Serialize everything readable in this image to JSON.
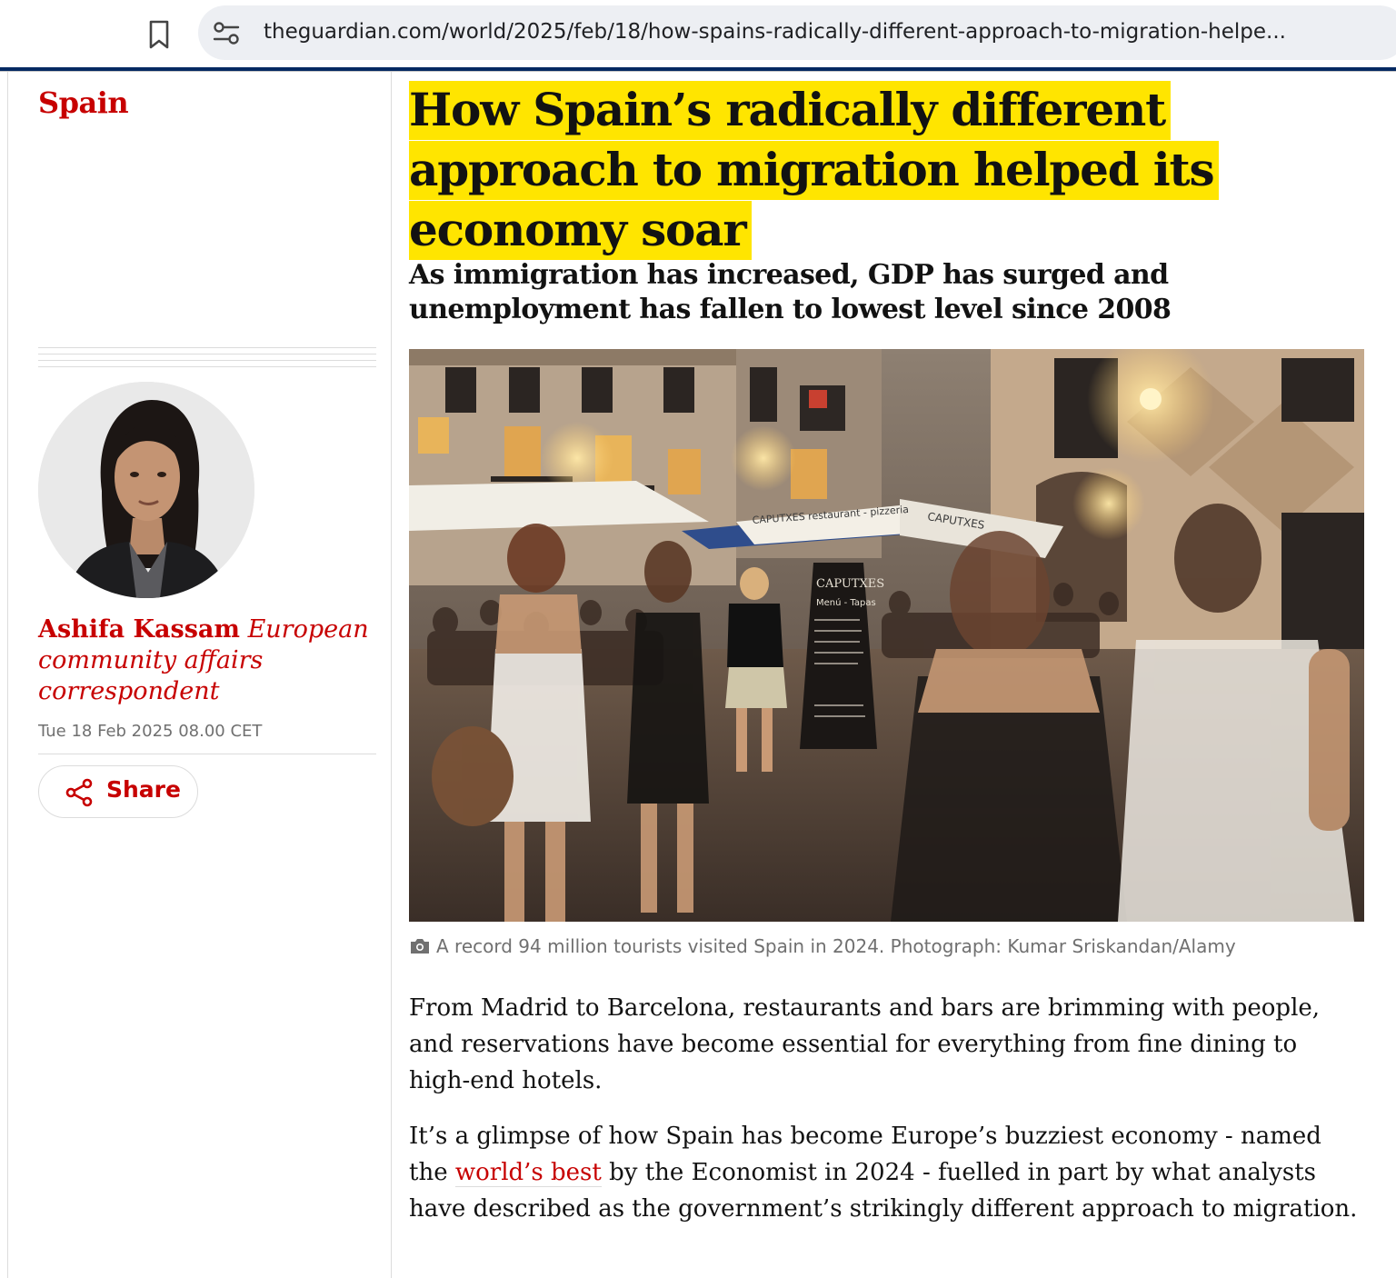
{
  "browser": {
    "url": "theguardian.com/world/2025/feb/18/how-spains-radically-different-approach-to-migration-helpe..."
  },
  "section": {
    "label": "Spain"
  },
  "author": {
    "name": "Ashifa Kassam",
    "role": "European community affairs correspondent",
    "date": "Tue 18 Feb 2025 08.00 CET"
  },
  "share": {
    "label": "Share"
  },
  "article": {
    "headline": "How Spain’s radically different approach to migration helped its economy soar",
    "standfirst": "As immigration has increased, GDP has surged and unemployment has fallen to lowest level since 2008",
    "caption": "A record 94 million tourists visited Spain in 2024. Photograph: Kumar Sriskandan/Alamy",
    "p1": "From Madrid to Barcelona, restaurants and bars are brimming with people, and reservations have become essential for everything from fine dining to high-end hotels.",
    "p2_before": "It’s a glimpse of how Spain has become Europe’s buzziest economy - named the ",
    "p2_link": "world’s best",
    "p2_after": " by the Economist in 2024 - fuelled in part by what analysts have described as the government’s strikingly different approach to migration."
  },
  "photo_signage": {
    "awning_left": "CAPUTXES restaurant - pizzeria",
    "awning_right": "CAPUTXES",
    "board_title": "CAPUTXES",
    "board_sub": "Menú - Tapas"
  },
  "colors": {
    "guardian_red": "#c70000",
    "highlight_yellow": "#ffe500",
    "guardian_navy": "#052962"
  }
}
